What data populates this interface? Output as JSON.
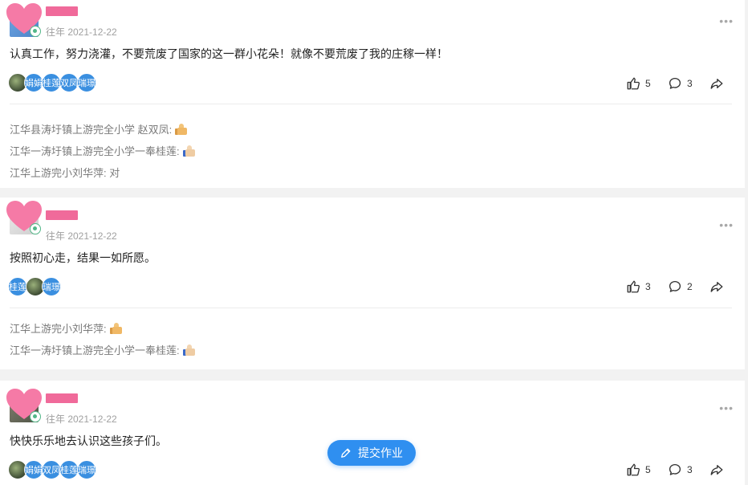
{
  "posts": [
    {
      "date": "往年 2021-12-22",
      "content": "认真工作，努力浇灌，不要荒废了国家的这一群小花朵！就像不要荒废了我的庄稼一样！",
      "likers": [
        "",
        "娟娟",
        "桂莲",
        "双凤",
        "瑞璟"
      ],
      "likes": "5",
      "comments_count": "3",
      "comments": [
        {
          "text": "江华县涛圩镇上游完全小学 赵双凤:",
          "emoji": "thumbs-up-icon"
        },
        {
          "text": "江华一涛圩镇上游完全小学一奉桂莲:",
          "emoji": "thumbs-up-blue-icon"
        },
        {
          "text": "江华上游完小刘华萍: 对",
          "emoji": ""
        }
      ]
    },
    {
      "date": "往年 2021-12-22",
      "content": "按照初心走，结果一如所愿。",
      "likers": [
        "桂莲",
        "",
        "瑞璟"
      ],
      "likes": "3",
      "comments_count": "2",
      "comments": [
        {
          "text": "江华上游完小刘华萍:",
          "emoji": "thumbs-up-icon"
        },
        {
          "text": "江华一涛圩镇上游完全小学一奉桂莲:",
          "emoji": "thumbs-up-blue-icon"
        }
      ]
    },
    {
      "date": "往年 2021-12-22",
      "content": "快快乐乐地去认识这些孩子们。",
      "likers": [
        "",
        "娟娟",
        "双凤",
        "桂莲",
        "瑞璟"
      ],
      "likes": "5",
      "comments_count": "3",
      "comments": []
    }
  ],
  "more_label": "•••",
  "submit_button": {
    "label": "提交作业"
  },
  "colors": {
    "accent": "#2f8ff0",
    "mask": "#f06a9a"
  }
}
